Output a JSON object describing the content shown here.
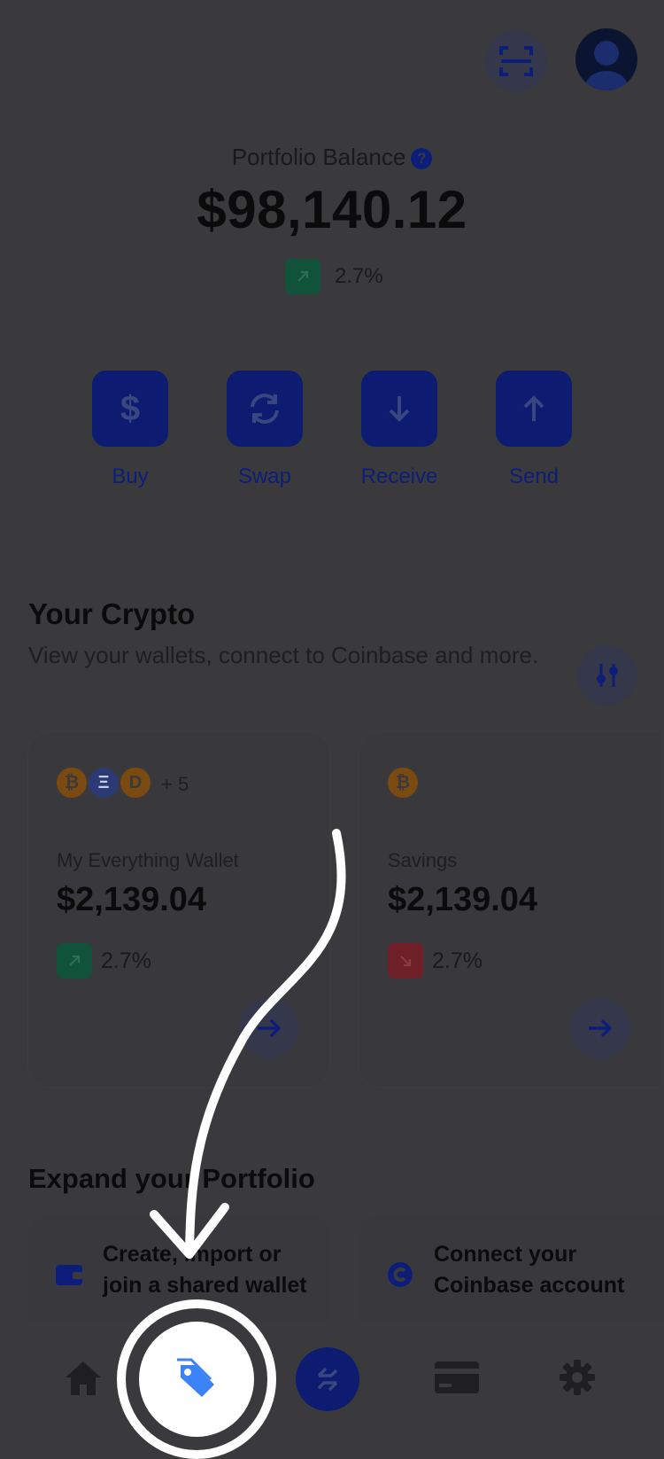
{
  "header": {
    "scan_icon": "qr-scan-icon",
    "avatar_icon": "user-avatar-icon"
  },
  "portfolio": {
    "label": "Portfolio Balance",
    "help_icon": "?",
    "balance": "$98,140.12",
    "change": "2.7%"
  },
  "actions": [
    {
      "label": "Buy",
      "icon": "dollar-icon"
    },
    {
      "label": "Swap",
      "icon": "swap-icon"
    },
    {
      "label": "Receive",
      "icon": "arrow-down-icon"
    },
    {
      "label": "Send",
      "icon": "arrow-up-icon"
    }
  ],
  "crypto": {
    "title": "Your Crypto",
    "subtitle": "View your wallets, connect to Coinbase and more.",
    "filter_icon": "sliders-icon",
    "wallets": [
      {
        "coins": [
          "₿",
          "Ξ",
          "D"
        ],
        "extra": "+ 5",
        "name": "My Everything Wallet",
        "balance": "$2,139.04",
        "change": "2.7%",
        "direction": "up"
      },
      {
        "coins": [
          "₿"
        ],
        "extra": "",
        "name": "Savings",
        "balance": "$2,139.04",
        "change": "2.7%",
        "direction": "down"
      }
    ]
  },
  "expand": {
    "title": "Expand your Portfolio",
    "cards": [
      {
        "text": "Create, import or join a shared wallet",
        "icon": "wallet-icon"
      },
      {
        "text": "Connect your Coinbase account",
        "icon": "coinbase-icon"
      }
    ]
  },
  "nav": {
    "items": [
      "home-icon",
      "tag-icon",
      "swap-icon",
      "card-icon",
      "gear-icon"
    ]
  },
  "colors": {
    "overlay_bg": "#3a3a3d",
    "primary": "#0d1b70",
    "highlight": "#3b82f6",
    "up": "#10533a",
    "down": "#6f1f27"
  }
}
